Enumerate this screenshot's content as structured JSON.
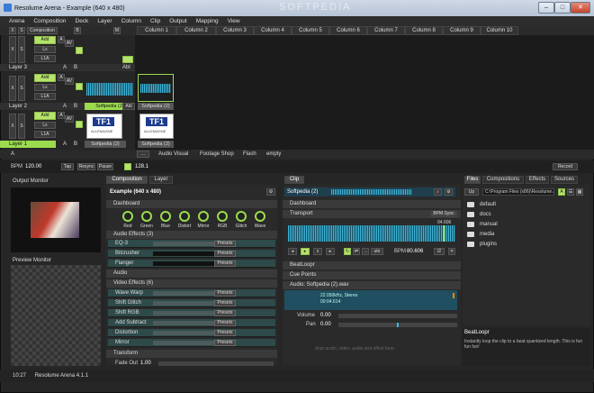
{
  "window": {
    "title": "Resolume Arena - Example (640 x 480)",
    "watermark": "SOFTPEDIA"
  },
  "menu": [
    "Arena",
    "Composition",
    "Deck",
    "Layer",
    "Column",
    "Clip",
    "Output",
    "Mapping",
    "View"
  ],
  "deck_header": {
    "x": "X",
    "s": "S",
    "composition": "Composition",
    "b": "B",
    "m": "M"
  },
  "columns": [
    "Column 1",
    "Column 2",
    "Column 3",
    "Column 4",
    "Column 5",
    "Column 6",
    "Column 7",
    "Column 8",
    "Column 9",
    "Column 10"
  ],
  "layer_controls": {
    "add": "Add",
    "lx": "Lx",
    "l1a": "L1A",
    "a": "A",
    "b": "B",
    "abl": "Abl",
    "av": "AV",
    "x": "X",
    "s": "S"
  },
  "layers": [
    {
      "name": "Layer 3"
    },
    {
      "name": "Layer 2",
      "clip_label": "Softpedia (2)",
      "clip2_label": "Softpedia (2)"
    },
    {
      "name": "Layer 1",
      "clip_label": "Softpedia (2)",
      "clip2_label": "Softpedia (2)"
    }
  ],
  "tf1": {
    "logo": "TF1",
    "sub": "ALLEMAGNE"
  },
  "decks": {
    "a": "A",
    "more": "...",
    "items": [
      "Audio Visual",
      "Footage Shop",
      "Flash",
      "empty"
    ]
  },
  "transport_bar": {
    "bpm_label": "BPM",
    "bpm": "120.00",
    "tap": "Tap",
    "resync": "Resync",
    "pause": "Pause",
    "tempo": "128.1",
    "record": "Record"
  },
  "output_monitor": {
    "title": "Output Monitor"
  },
  "preview_monitor": {
    "title": "Preview Monitor"
  },
  "comp_panel": {
    "tabs": [
      "Composition",
      "Layer"
    ],
    "name": "Example (640 x 480)",
    "dashboard": "Dashboard",
    "knobs": [
      "Red",
      "Green",
      "Blue",
      "Distort",
      "Mirror",
      "RGB",
      "Glitch",
      "Wave"
    ],
    "audio_effects": "Audio Effects (3)",
    "audio_fx": [
      "EQ-3",
      "Bitcrusher",
      "Flanger"
    ],
    "audio": "Audio",
    "video_effects": "Video Effects (6)",
    "video_fx": [
      "Wave Warp",
      "Shift Glitch",
      "Shift RGB",
      "Add Subtract",
      "Distortion",
      "Mirror"
    ],
    "presets": "Presets",
    "transform": "Transform",
    "fade_out_label": "Fade Out",
    "fade_out": "1.00"
  },
  "clip_panel": {
    "tab": "Clip",
    "name": "Softpedia (2)",
    "dashboard": "Dashboard",
    "transport": "Transport",
    "bpm_sync": "BPM Sync",
    "time": "04.606",
    "bpm_label": "BPM",
    "bpm": "80.606",
    "beat": "/2",
    "mode": "uto",
    "beatloopr": "BeatLoopr",
    "cue_points": "Cue Points",
    "audio_section": "Audio: Softpedia (2).wav",
    "audio_info1": "22.050kHz, Stereo",
    "audio_info2": "00:04.614",
    "volume_label": "Volume",
    "volume": "0.00",
    "pan_label": "Pan",
    "pan": "0.00",
    "drop_hint": "drop audio, video, audio and effect here"
  },
  "browser": {
    "tabs": [
      "Files",
      "Compositions",
      "Effects",
      "Sources"
    ],
    "up": "Up",
    "path": "C:\\Program Files (x86)\\Resolume Are...",
    "folders": [
      "default",
      "docs",
      "manual",
      "media",
      "plugins"
    ]
  },
  "help": {
    "title": "BeatLoopr",
    "text": "Instantly loop the clip to a beat quantized length. This is fun fun fun!"
  },
  "status": {
    "time": "10:27",
    "app": "Resolume Arena 4.1.1"
  },
  "colors": {
    "accent_green": "#b6e36b",
    "wave_blue": "#3fb6d9",
    "fx_teal": "#2f4a4a"
  }
}
